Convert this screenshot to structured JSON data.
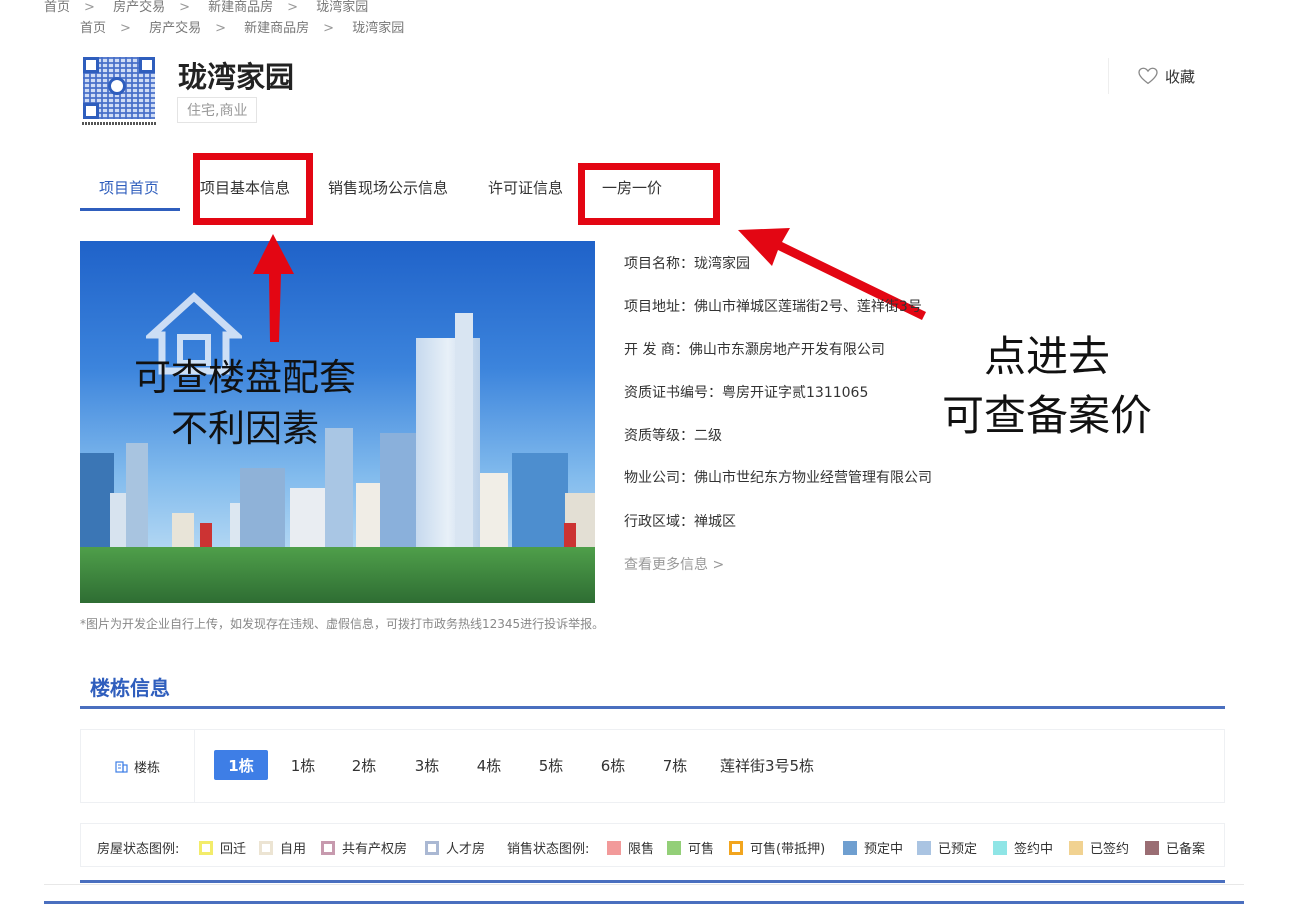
{
  "breadcrumb_ghost": [
    "首页",
    "房产交易",
    "新建商品房",
    "珑湾家园"
  ],
  "breadcrumb": [
    "首页",
    "房产交易",
    "新建商品房",
    "珑湾家园"
  ],
  "breadcrumb_sep": ">",
  "project": {
    "title": "珑湾家园",
    "tag": "住宅,商业"
  },
  "favorite_label": "收藏",
  "tabs": [
    {
      "label": "项目首页",
      "active": true
    },
    {
      "label": "项目基本信息",
      "active": false
    },
    {
      "label": "销售现场公示信息",
      "active": false
    },
    {
      "label": "许可证信息",
      "active": false
    },
    {
      "label": "一房一价",
      "active": false
    }
  ],
  "annotations": {
    "left_line1": "可查楼盘配套",
    "left_line2": "不利因素",
    "right_line1": "点进去",
    "right_line2": "可查备案价",
    "box_color": "#e30613"
  },
  "info": [
    {
      "label": "项目名称：",
      "value": "珑湾家园"
    },
    {
      "label": "项目地址：",
      "value": "佛山市禅城区莲瑞街2号、莲祥街3号"
    },
    {
      "label": "开 发 商：",
      "value": "佛山市东灏房地产开发有限公司"
    },
    {
      "label": "资质证书编号：",
      "value": "粤房开证字贰1311065"
    },
    {
      "label": "资质等级：",
      "value": "二级"
    },
    {
      "label": "物业公司：",
      "value": "佛山市世纪东方物业经营管理有限公司"
    },
    {
      "label": "行政区域：",
      "value": "禅城区"
    }
  ],
  "more_info": "查看更多信息 >",
  "image_note": "*图片为开发企业自行上传，如发现存在违规、虚假信息，可拨打市政务热线12345进行投诉举报。",
  "building_section": {
    "title": "楼栋信息",
    "label": "楼栋",
    "buildings": [
      "1栋",
      "1栋",
      "2栋",
      "3栋",
      "4栋",
      "5栋",
      "6栋",
      "7栋",
      "莲祥街3号5栋"
    ]
  },
  "legend": {
    "house_title": "房屋状态图例:",
    "house": [
      {
        "label": "回迁",
        "color": "#f3ec6a"
      },
      {
        "label": "自用",
        "color": "#ece4d3"
      },
      {
        "label": "共有产权房",
        "color": "#c79aae"
      },
      {
        "label": "人才房",
        "color": "#aab8d3"
      }
    ],
    "sale_title": "销售状态图例:",
    "sale": [
      {
        "label": "限售",
        "color": "#f29a9a",
        "hollow": false
      },
      {
        "label": "可售",
        "color": "#93cf78",
        "hollow": false
      },
      {
        "label": "可售(带抵押)",
        "color": "#f2a51e",
        "hollow": true
      },
      {
        "label": "预定中",
        "color": "#6f9fd0",
        "hollow": false
      },
      {
        "label": "已预定",
        "color": "#aac4e2",
        "hollow": false
      },
      {
        "label": "签约中",
        "color": "#8fe5e6",
        "hollow": false
      },
      {
        "label": "已签约",
        "color": "#f1d291",
        "hollow": false
      },
      {
        "label": "已备案",
        "color": "#9a6d73",
        "hollow": false
      }
    ]
  }
}
